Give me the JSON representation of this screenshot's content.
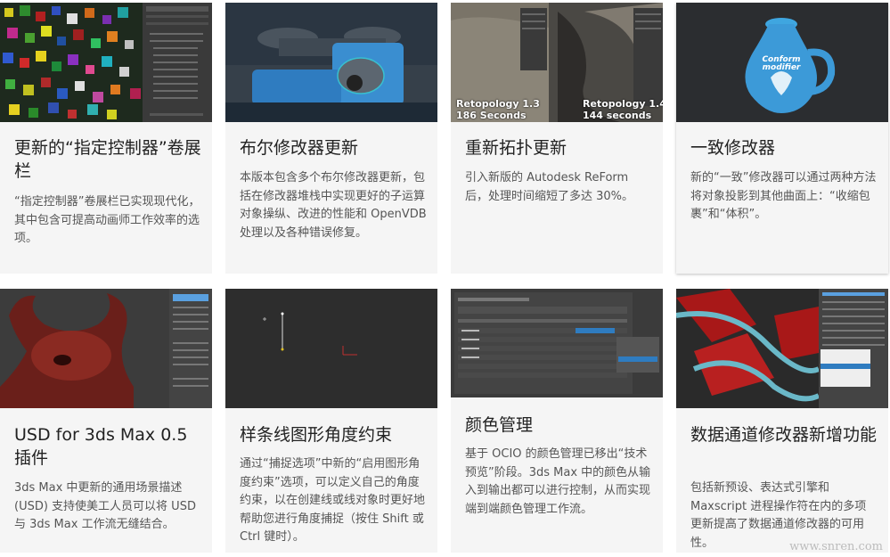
{
  "cards": [
    {
      "title": "更新的“指定控制器”卷展栏",
      "desc": "“指定控制器”卷展栏已实现现代化，其中包含可提高动画师工作效率的选项。"
    },
    {
      "title": "布尔修改器更新",
      "desc": "本版本包含多个布尔修改器更新，包括在修改器堆栈中实现更好的子运算对象操纵、改进的性能和 OpenVDB 处理以及各种错误修复。"
    },
    {
      "title": "重新拓扑更新",
      "desc": "引入新版的 Autodesk ReForm 后，处理时间缩短了多达 30%。",
      "overlay_left": "Retopology 1.3\n186 Seconds",
      "overlay_right": "Retopology 1.4\n144 seconds"
    },
    {
      "title": "一致修改器",
      "desc": "新的“一致”修改器可以通过两种方法将对象投影到其他曲面上：“收缩包裹”和“体积”。",
      "jug_text": "Conform\nmodifier"
    },
    {
      "title": "USD for 3ds Max 0.5 插件",
      "desc": "3ds Max 中更新的通用场景描述 (USD) 支持使美工人员可以将 USD 与 3ds Max 工作流无缝结合。"
    },
    {
      "title": "样条线图形角度约束",
      "desc": "通过“捕捉选项”中新的“启用图形角度约束”选项，可以定义自己的角度约束，以在创建线或线对象时更好地帮助您进行角度捕捉（按住 Shift 或 Ctrl 键时）。"
    },
    {
      "title": "颜色管理",
      "desc": "基于 OCIO 的颜色管理已移出“技术预览”阶段。3ds Max 中的颜色从输入到输出都可以进行控制，从而实现端到端颜色管理工作流。"
    },
    {
      "title": "数据通道修改器新增功能",
      "desc": "包括新预设、表达式引擎和 Maxscript 进程操作符在内的多项更新提高了数据通道修改器的可用性。"
    }
  ],
  "watermark": "www.snren.com"
}
